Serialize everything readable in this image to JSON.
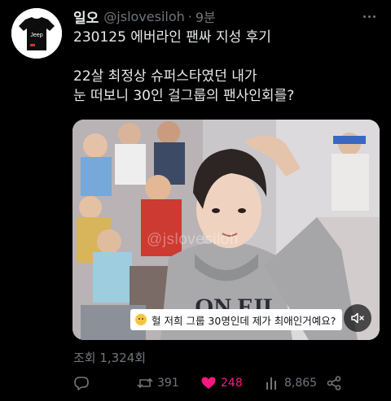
{
  "user": {
    "display_name": "일오",
    "handle": "@jslovesiloh",
    "separator": "·",
    "time": "9분",
    "avatar_icon": "avatar-tshirt-icon",
    "avatar_shirt_text": "Jeep"
  },
  "tweet": {
    "lines": [
      "230125 에버라인 팬싸 지성 후기",
      "",
      "22살 최정상 슈퍼스타였던 내가",
      "눈 떠보니 30인 걸그룹의 팬사인회를?"
    ]
  },
  "media": {
    "watermark": "@jslovesiloh",
    "caption": "헐 저희 그룹 30명인데 제가 최애인거예요?",
    "mute_icon": "volume-mute-icon"
  },
  "views_text": "조회 1,324회",
  "actions": {
    "reply": {
      "icon": "reply-icon",
      "count": ""
    },
    "retweet": {
      "icon": "retweet-icon",
      "count": "391"
    },
    "like": {
      "icon": "heart-filled-icon",
      "count": "248",
      "color": "#f91880"
    },
    "views": {
      "icon": "bar-chart-icon",
      "count": "8,865"
    },
    "share": {
      "icon": "share-icon",
      "count": ""
    }
  },
  "colors": {
    "background": "#000000",
    "text": "#e7e9ea",
    "muted": "#71767b",
    "like": "#f91880"
  }
}
